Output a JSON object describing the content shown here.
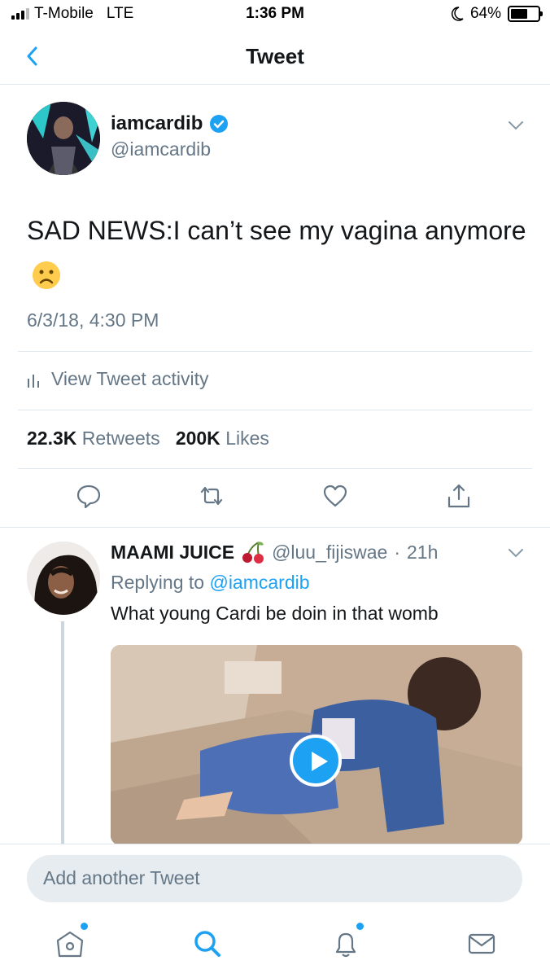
{
  "status_bar": {
    "carrier": "T-Mobile",
    "network": "LTE",
    "time": "1:36 PM",
    "battery": "64%",
    "battery_level": 0.64
  },
  "nav": {
    "title": "Tweet",
    "back_icon": "chevron-left-icon"
  },
  "main_tweet": {
    "author_name": "iamcardib",
    "author_handle": "@iamcardib",
    "text": "SAD NEWS:I can’t see my vagina anymore",
    "emoji": "sad-face-emoji",
    "date": "6/3/18, 4:30 PM",
    "activity_label": "View Tweet activity",
    "retweets_count": "22.3K",
    "retweets_label": "Retweets",
    "likes_count": "200K",
    "likes_label": "Likes"
  },
  "reply": {
    "author_name": "MAAMI JUICE",
    "emoji": "cherries-emoji",
    "handle": "@luu_fijiswae",
    "separator": "·",
    "time": "21h",
    "replying_prefix": "Replying to",
    "replying_mention": "@iamcardib",
    "text": "What young Cardi be doin in that womb"
  },
  "compose": {
    "placeholder": "Add another Tweet"
  },
  "tabbar": {
    "items": [
      "home-icon",
      "search-icon",
      "notifications-icon",
      "messages-icon"
    ]
  },
  "colors": {
    "accent": "#1da1f2",
    "secondary_text": "#657786",
    "divider": "#e1e8ed"
  }
}
